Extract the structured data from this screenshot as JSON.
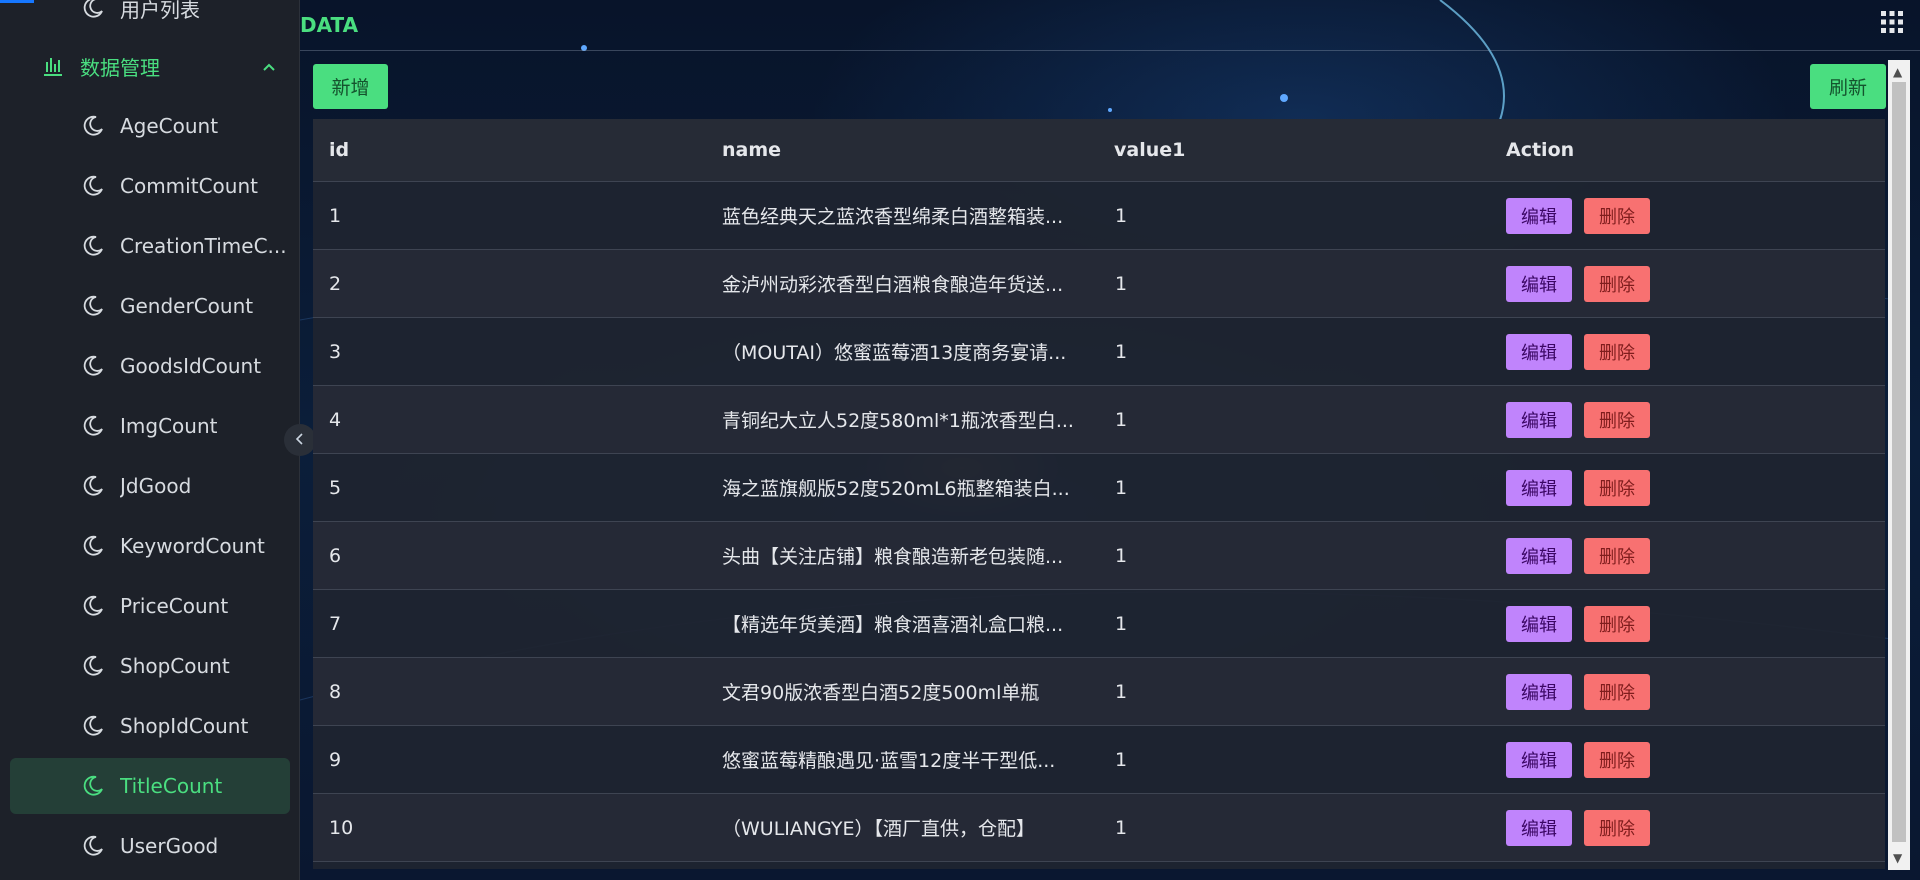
{
  "sidebar": {
    "items": [
      {
        "label": "用户列表",
        "type": "sub"
      },
      {
        "label": "数据管理",
        "type": "group"
      },
      {
        "label": "AgeCount",
        "type": "sub"
      },
      {
        "label": "CommitCount",
        "type": "sub"
      },
      {
        "label": "CreationTimeC...",
        "type": "sub"
      },
      {
        "label": "GenderCount",
        "type": "sub"
      },
      {
        "label": "GoodsIdCount",
        "type": "sub"
      },
      {
        "label": "ImgCount",
        "type": "sub"
      },
      {
        "label": "JdGood",
        "type": "sub"
      },
      {
        "label": "KeywordCount",
        "type": "sub"
      },
      {
        "label": "PriceCount",
        "type": "sub"
      },
      {
        "label": "ShopCount",
        "type": "sub"
      },
      {
        "label": "ShopIdCount",
        "type": "sub"
      },
      {
        "label": "TitleCount",
        "type": "sub",
        "active": true
      },
      {
        "label": "UserGood",
        "type": "sub"
      }
    ]
  },
  "header": {
    "title": "DATA"
  },
  "toolbar": {
    "add_label": "新增",
    "refresh_label": "刷新"
  },
  "table": {
    "columns": [
      "id",
      "name",
      "value1",
      "Action"
    ],
    "edit_label": "编辑",
    "delete_label": "删除",
    "rows": [
      {
        "id": "1",
        "name": "蓝色经典天之蓝浓香型绵柔白酒整箱装...",
        "value1": "1"
      },
      {
        "id": "2",
        "name": "金泸州动彩浓香型白酒粮食酿造年货送...",
        "value1": "1"
      },
      {
        "id": "3",
        "name": "（MOUTAI）悠蜜蓝莓酒13度商务宴请...",
        "value1": "1"
      },
      {
        "id": "4",
        "name": "青铜纪大立人52度580ml*1瓶浓香型白...",
        "value1": "1"
      },
      {
        "id": "5",
        "name": "海之蓝旗舰版52度520mL6瓶整箱装白...",
        "value1": "1"
      },
      {
        "id": "6",
        "name": "头曲【关注店铺】粮食酿造新老包装随...",
        "value1": "1"
      },
      {
        "id": "7",
        "name": "【精选年货美酒】粮食酒喜酒礼盒口粮...",
        "value1": "1"
      },
      {
        "id": "8",
        "name": "文君90版浓香型白酒52度500ml单瓶",
        "value1": "1"
      },
      {
        "id": "9",
        "name": "悠蜜蓝莓精酿遇见·蓝雪12度半干型低...",
        "value1": "1"
      },
      {
        "id": "10",
        "name": "（WULIANGYE）【酒厂直供，仓配】",
        "value1": "1"
      }
    ]
  },
  "colors": {
    "accent": "#4ade80",
    "edit": "#c084fc",
    "delete": "#f87171",
    "sidebar_bg": "#1d2129"
  }
}
